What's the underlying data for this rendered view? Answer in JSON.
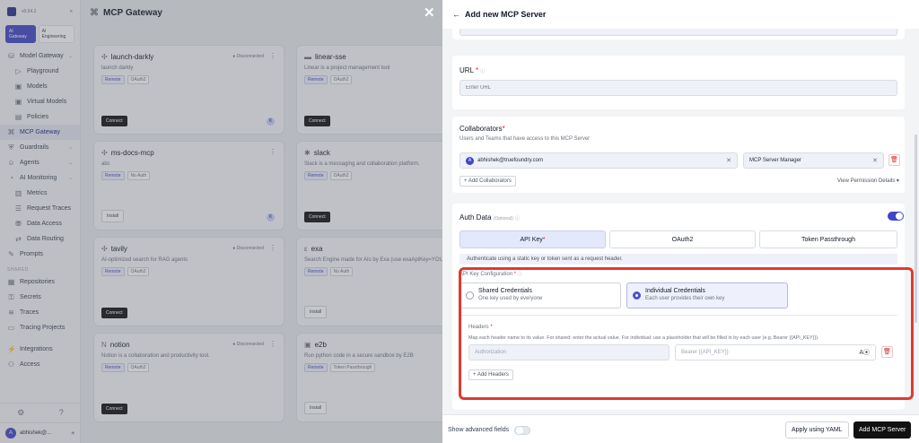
{
  "sidebar": {
    "version": "v0.54.2",
    "tabs": [
      "AI Gateway",
      "AI Engineering"
    ],
    "items": [
      {
        "icon": "gateway-icon",
        "label": "Model Gateway",
        "sub": false,
        "active": false,
        "chev": true
      },
      {
        "icon": "playground-icon",
        "label": "Playground",
        "sub": true,
        "active": false
      },
      {
        "icon": "cube-icon",
        "label": "Models",
        "sub": true,
        "active": false
      },
      {
        "icon": "cube-icon",
        "label": "Virtual Models",
        "sub": true,
        "active": false
      },
      {
        "icon": "policy-icon",
        "label": "Policies",
        "sub": true,
        "active": false
      },
      {
        "icon": "mcp-icon",
        "label": "MCP Gateway",
        "sub": false,
        "active": true
      },
      {
        "icon": "shield-icon",
        "label": "Guardrails",
        "sub": false,
        "active": false,
        "chev": true
      },
      {
        "icon": "agent-icon",
        "label": "Agents",
        "sub": false,
        "active": false,
        "chev": true
      },
      {
        "icon": "monitor-icon",
        "label": "AI Monitoring",
        "sub": false,
        "active": false,
        "chev": true
      },
      {
        "icon": "chart-icon",
        "label": "Metrics",
        "sub": true,
        "active": false
      },
      {
        "icon": "list-icon",
        "label": "Request Traces",
        "sub": true,
        "active": false
      },
      {
        "icon": "database-icon",
        "label": "Data Access",
        "sub": true,
        "active": false
      },
      {
        "icon": "route-icon",
        "label": "Data Routing",
        "sub": true,
        "active": false
      },
      {
        "icon": "prompt-icon",
        "label": "Prompts",
        "sub": false,
        "active": false
      }
    ],
    "section_shared": "SHARED",
    "shared_items": [
      {
        "icon": "repo-icon",
        "label": "Repositories"
      },
      {
        "icon": "key-icon",
        "label": "Secrets"
      },
      {
        "icon": "trace-icon",
        "label": "Traces"
      },
      {
        "icon": "folder-icon",
        "label": "Tracing Projects"
      }
    ],
    "bottom_items": [
      {
        "icon": "plug-icon",
        "label": "Integrations"
      },
      {
        "icon": "access-icon",
        "label": "Access"
      }
    ],
    "user": "abhishek@..."
  },
  "main": {
    "title": "MCP Gateway",
    "cards": [
      {
        "name": "launch-darkly",
        "status": "Disconnected",
        "desc": "launch darkly",
        "tags": [
          "Remote",
          "OAuth2"
        ],
        "button": "Connect",
        "dark": true,
        "avatar": "K"
      },
      {
        "name": "linear-sse",
        "status": "",
        "desc": "Linear is a project management tool",
        "tags": [
          "Remote",
          "OAuth2"
        ],
        "button": "Connect",
        "dark": true,
        "avatar": ""
      },
      {
        "name": "ms-docs-mcp",
        "status": "",
        "desc": "abc",
        "tags": [
          "Remote",
          "No Auth"
        ],
        "button": "Install",
        "dark": false,
        "avatar": "K"
      },
      {
        "name": "slack",
        "status": "",
        "desc": "Slack is a messaging and collaboration platform.",
        "tags": [
          "Remote",
          "OAuth2"
        ],
        "button": "Connect",
        "dark": true,
        "avatar": ""
      },
      {
        "name": "tavily",
        "status": "Disconnected",
        "desc": "AI-optimized search for RAG agents",
        "tags": [
          "Remote",
          "OAuth2"
        ],
        "button": "Connect",
        "dark": true,
        "avatar": ""
      },
      {
        "name": "exa",
        "status": "",
        "desc": "Search Engine made for AIs by Exa (use exaApiKey=YOUR_EXA_API_KEY in the URL if you",
        "tags": [
          "Remote",
          "No Auth"
        ],
        "button": "Install",
        "dark": false,
        "avatar": ""
      },
      {
        "name": "notion",
        "status": "Disconnected",
        "desc": "Notion is a collaboration and productivity tool.",
        "tags": [
          "Remote",
          "OAuth2"
        ],
        "button": "Connect",
        "dark": true,
        "avatar": ""
      },
      {
        "name": "e2b",
        "status": "",
        "desc": "Run python code in a secure sandbox by E2B",
        "tags": [
          "Remote",
          "Token Passthrough"
        ],
        "button": "Install",
        "dark": false,
        "avatar": ""
      }
    ]
  },
  "drawer": {
    "title": "Add new MCP Server",
    "url": {
      "label": "URL",
      "placeholder": "Enter URL"
    },
    "collaborators": {
      "label": "Collaborators",
      "sub": "Users and Teams that have access to this MCP Server",
      "user": "abhishek@truefoundry.com",
      "role": "MCP Server Manager",
      "add": "+ Add Collaborators",
      "view": "View Permission Details"
    },
    "auth": {
      "label": "Auth Data",
      "optional": "(Optional)",
      "tabs": [
        "API Key",
        "OAuth2",
        "Token Passthrough"
      ],
      "note": "Authenticate using a static key or token sent as a request header.",
      "config_label": "API Key Configuration",
      "shared": {
        "title": "Shared Credentials",
        "desc": "One key used by everyone"
      },
      "individual": {
        "title": "Individual Credentials",
        "desc": "Each user provides their own key"
      },
      "headers_label": "Headers",
      "headers_help": "Map each header name to its value. For shared: enter the actual value. For individual: use a placeholder that will be filled in by each user (e.g. Bearer {{API_KEY}}).",
      "header_name": "Authorization",
      "header_value": "Bearer {{API_KEY}}",
      "add_headers": "+ Add Headers"
    },
    "footer": {
      "advanced": "Show advanced fields",
      "yaml": "Apply using YAML",
      "submit": "Add MCP Server"
    }
  },
  "colors": {
    "accent": "#3f46c7",
    "highlight": "#e03a2e",
    "dark_button": "#111111"
  }
}
